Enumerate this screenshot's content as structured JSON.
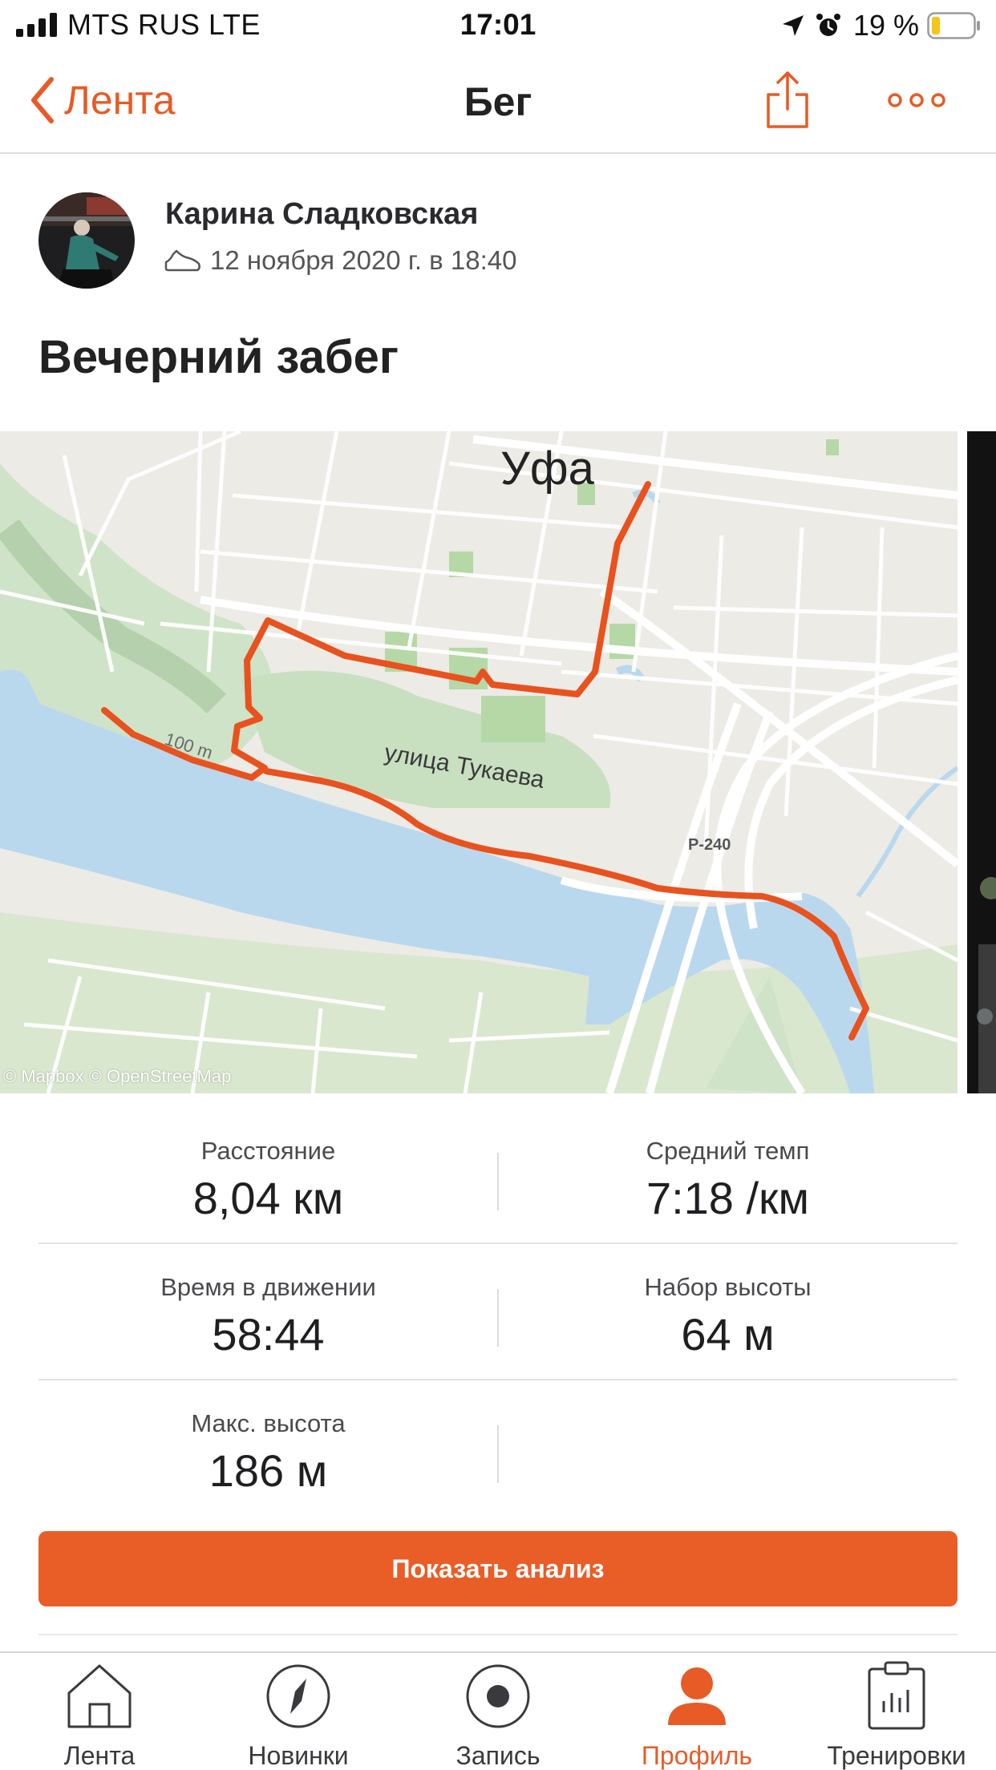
{
  "status_bar": {
    "carrier": "MTS RUS   LTE",
    "time": "17:01",
    "battery_percent": "19 %",
    "battery_level": 0.19,
    "icons": [
      "signal-bars-icon",
      "location-arrow-icon",
      "alarm-clock-icon",
      "battery-icon"
    ]
  },
  "nav": {
    "back_label": "Лента",
    "title": "Бег",
    "icons": [
      "chevron-left-icon",
      "share-icon",
      "more-dots-icon"
    ]
  },
  "athlete": {
    "name": "Карина Сладковская",
    "date": "12 ноября 2020 г. в 18:40",
    "activity_icon": "shoe-icon"
  },
  "activity": {
    "title": "Вечерний забег"
  },
  "map": {
    "city_label": "Уфа",
    "street_label": "улица Тукаева",
    "scale_label": "100 m",
    "road_label": "Р-240",
    "credit": "© Mapbox © OpenStreetMap",
    "route_color": "#e8521e"
  },
  "stats": [
    [
      {
        "label": "Расстояние",
        "value": "8,04 км"
      },
      {
        "label": "Средний темп",
        "value": "7:18 /км"
      }
    ],
    [
      {
        "label": "Время в движении",
        "value": "58:44"
      },
      {
        "label": "Набор высоты",
        "value": "64 м"
      }
    ],
    [
      {
        "label": "Макс. высота",
        "value": "186 м"
      }
    ]
  ],
  "analysis_button": "Показать анализ",
  "tabs": [
    {
      "label": "Лента",
      "icon": "home-icon"
    },
    {
      "label": "Новинки",
      "icon": "compass-icon"
    },
    {
      "label": "Запись",
      "icon": "record-icon"
    },
    {
      "label": "Профиль",
      "icon": "profile-icon",
      "active": true
    },
    {
      "label": "Тренировки",
      "icon": "clipboard-chart-icon"
    }
  ],
  "colors": {
    "accent": "#e95d27",
    "text": "#242428",
    "water": "#b9d8ee",
    "park": "#cfe8c4"
  }
}
